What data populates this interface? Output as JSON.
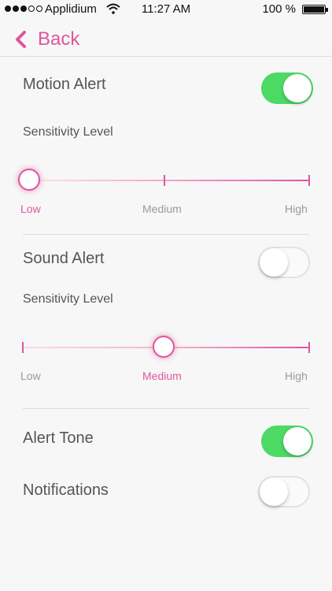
{
  "status": {
    "carrier": "Applidium",
    "time": "11:27 AM",
    "battery": "100 %"
  },
  "nav": {
    "back_label": "Back"
  },
  "accent": "#e0559e",
  "toggle_on_color": "#4cd964",
  "motion": {
    "label": "Motion Alert",
    "enabled": true,
    "sensitivity_label": "Sensitivity Level",
    "levels": [
      "Low",
      "Medium",
      "High"
    ],
    "selected": "Low"
  },
  "sound": {
    "label": "Sound Alert",
    "enabled": false,
    "sensitivity_label": "Sensitivity Level",
    "levels": [
      "Low",
      "Medium",
      "High"
    ],
    "selected": "Medium"
  },
  "alert_tone": {
    "label": "Alert Tone",
    "enabled": true
  },
  "notifications": {
    "label": "Notifications",
    "enabled": false
  }
}
